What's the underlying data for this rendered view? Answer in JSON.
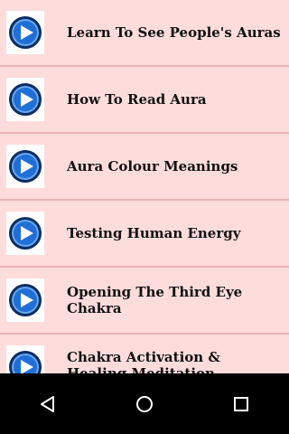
{
  "list": {
    "items": [
      {
        "title": "Learn To See People's Auras",
        "icon": "play-icon"
      },
      {
        "title": "How To Read Aura",
        "icon": "play-icon"
      },
      {
        "title": "Aura Colour Meanings",
        "icon": "play-icon"
      },
      {
        "title": "Testing Human Energy",
        "icon": "play-icon"
      },
      {
        "title": "Opening The Third Eye Chakra",
        "icon": "play-icon"
      },
      {
        "title": "Chakra Activation & Healing Meditation",
        "icon": "play-icon"
      }
    ]
  },
  "navbar": {
    "buttons": [
      "back-icon",
      "home-icon",
      "recents-icon"
    ]
  },
  "colors": {
    "background": "#ffdcdc",
    "divider": "#e8b4b4",
    "play_button": "#1f6fd6",
    "navbar": "#000000"
  }
}
